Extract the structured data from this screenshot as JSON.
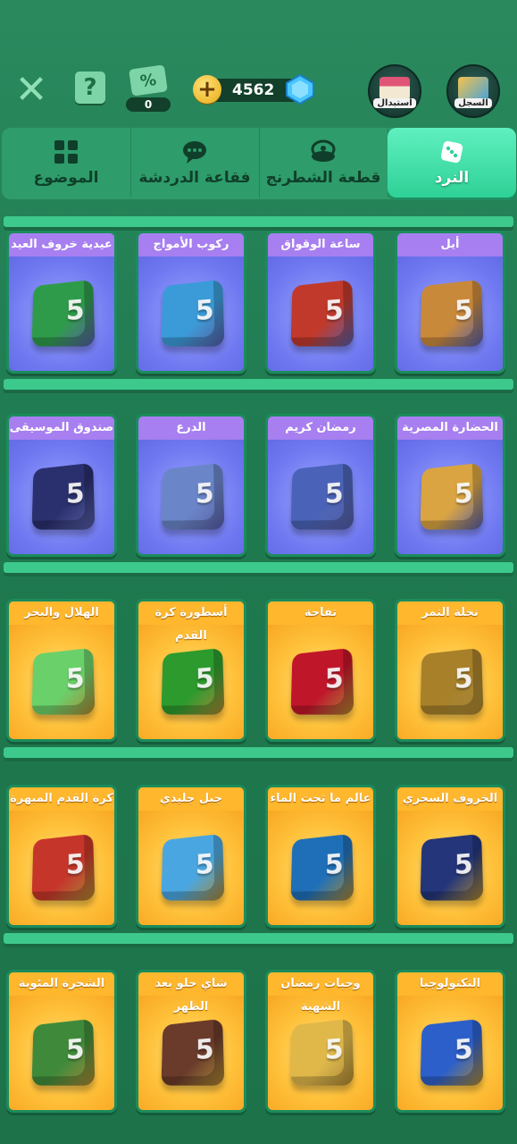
{
  "topbar": {
    "coupon_count": "0",
    "coins": "4562",
    "shop_label": "استبدال",
    "record_label": "السجل"
  },
  "tabs": [
    {
      "label": "النرد",
      "icon": "dice-icon",
      "active": true
    },
    {
      "label": "قطعة الشطرنج",
      "icon": "chess-piece-icon",
      "active": false
    },
    {
      "label": "فقاعة الدردشة",
      "icon": "chat-bubble-icon",
      "active": false
    },
    {
      "label": "الموضوع",
      "icon": "grid-theme-icon",
      "active": false
    }
  ],
  "rows": [
    [
      {
        "name": "أيل",
        "style": "blue",
        "color": "#c9893a"
      },
      {
        "name": "ساعة الوقواق",
        "style": "blue",
        "color": "#c0392b"
      },
      {
        "name": "ركوب الأمواج",
        "style": "blue",
        "color": "#3a9bd8"
      },
      {
        "name": "عيدية خروف العيد",
        "style": "blue",
        "color": "#2e9b4a"
      }
    ],
    [
      {
        "name": "الحضارة المصرية",
        "style": "blue",
        "color": "#d9a441"
      },
      {
        "name": "رمضان كريم",
        "style": "blue",
        "color": "#4a63b8"
      },
      {
        "name": "الدرع",
        "style": "blue",
        "color": "#6a86c9"
      },
      {
        "name": "صندوق الموسيقى",
        "style": "blue",
        "color": "#2a2f6e"
      }
    ],
    [
      {
        "name": "نخلة التمر",
        "style": "orange",
        "color": "#a8802a"
      },
      {
        "name": "تفاحة",
        "style": "orange",
        "color": "#c0162a"
      },
      {
        "name": "أسطورة كرة القدم",
        "style": "orange",
        "color": "#2d9a2d"
      },
      {
        "name": "الهلال والبحر",
        "style": "orange",
        "color": "#6ad06a"
      }
    ],
    [
      {
        "name": "الخروف السحري",
        "style": "orange",
        "color": "#24357a"
      },
      {
        "name": "عالم ما تحت الماء",
        "style": "orange",
        "color": "#1f6fb8"
      },
      {
        "name": "جبل جليدي",
        "style": "orange",
        "color": "#4aa6e0"
      },
      {
        "name": "كرة القدم المبهرة",
        "style": "orange",
        "color": "#c6352a"
      }
    ],
    [
      {
        "name": "التكنولوجيا",
        "style": "orange",
        "color": "#2c5fc9"
      },
      {
        "name": "وجبات رمضان الشهية",
        "style": "orange",
        "color": "#e0b84a"
      },
      {
        "name": "شاي حلو بعد الظهر",
        "style": "orange",
        "color": "#6a3a2a"
      },
      {
        "name": "الشجرة المئوية",
        "style": "orange",
        "color": "#3f8a3a"
      }
    ]
  ]
}
